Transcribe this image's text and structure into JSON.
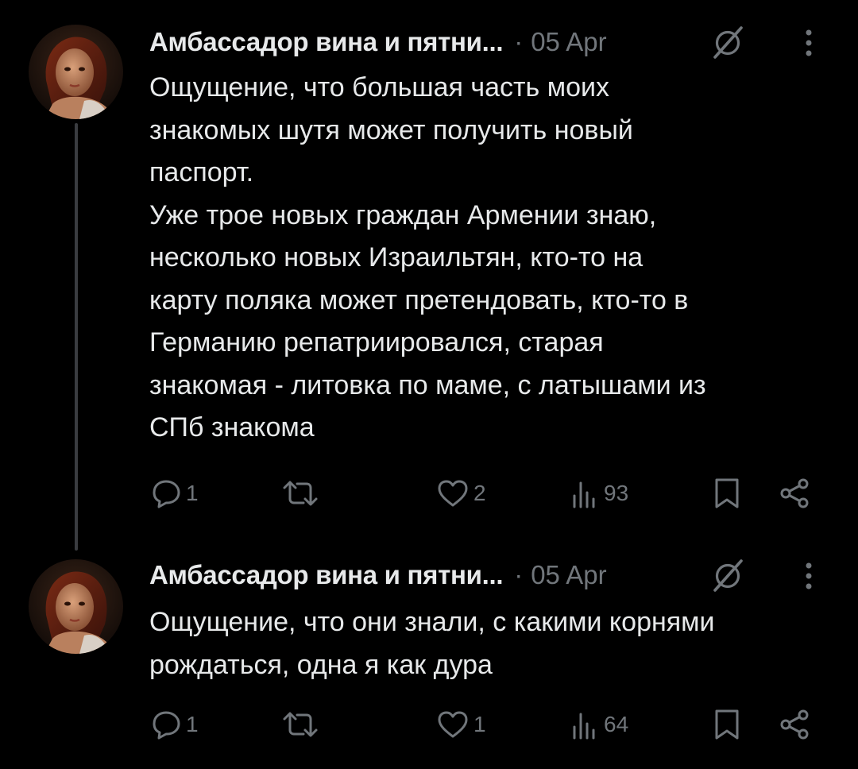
{
  "accent_color": "#000000",
  "posts": [
    {
      "author": "Амбассадор вина и пятни...",
      "separator": "·",
      "date": "05 Apr",
      "text": "Ощущение, что большая часть моих\nзнакомых шутя может получить новый\nпаспорт.\nУже трое новых граждан Армении знаю,\nнесколько новых Израильтян, кто-то на\nкарту поляка может претендовать, кто-то в\nГерманию репатриировался, старая\nзнакомая - литовка по маме, с латышами из\nСПб знакома",
      "replies": "1",
      "likes": "2",
      "views": "93"
    },
    {
      "author": "Амбассадор вина и пятни...",
      "separator": "·",
      "date": "05 Apr",
      "text": "Ощущение, что они знали, с какими корнями\nрождаться, одна я как дура",
      "replies": "1",
      "likes": "1",
      "views": "64"
    }
  ],
  "icons": {
    "reply": "speech-bubble-icon",
    "repost": "repost-arrows-icon",
    "like": "heart-icon",
    "views": "bar-chart-icon",
    "bookmark": "bookmark-icon",
    "share": "share-nodes-icon",
    "grok": "grok-slash-icon",
    "more": "vertical-dots-icon"
  }
}
